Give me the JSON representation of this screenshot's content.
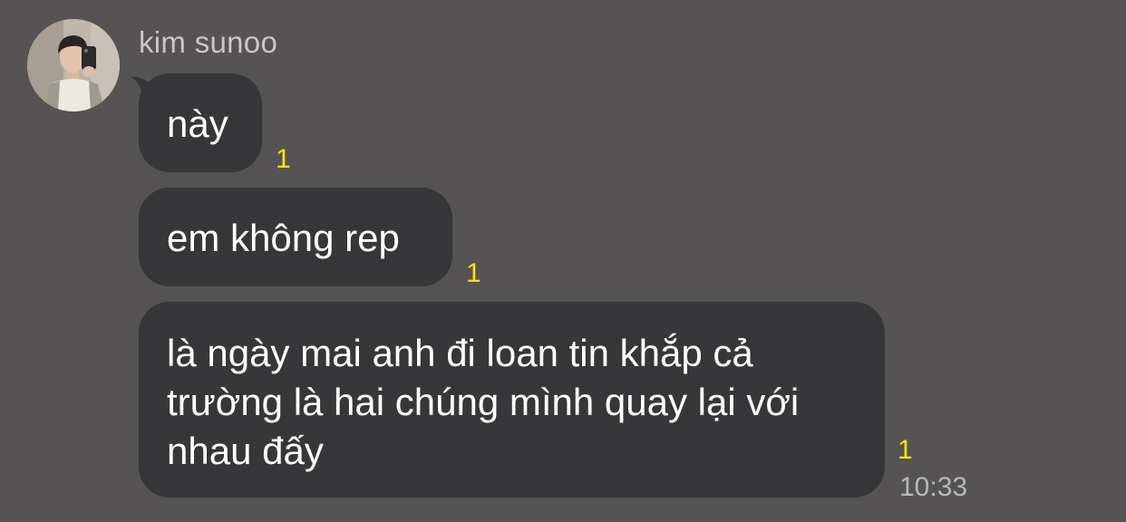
{
  "chat": {
    "sender_name": "kim sunoo",
    "messages": [
      {
        "text": "này",
        "unread_count": "1"
      },
      {
        "text": "em không rep",
        "unread_count": "1"
      },
      {
        "text": "là ngày mai anh đi loan tin khắp cả trường là hai chúng mình quay lại với nhau đấy",
        "unread_count": "1",
        "time": "10:33"
      }
    ]
  },
  "colors": {
    "background": "#555354",
    "bubble": "#373638",
    "unread_badge": "#f7e600",
    "sender_name": "#c9c7c8",
    "timestamp": "#b9b8b9"
  },
  "icons": {
    "avatar": "profile-photo"
  }
}
